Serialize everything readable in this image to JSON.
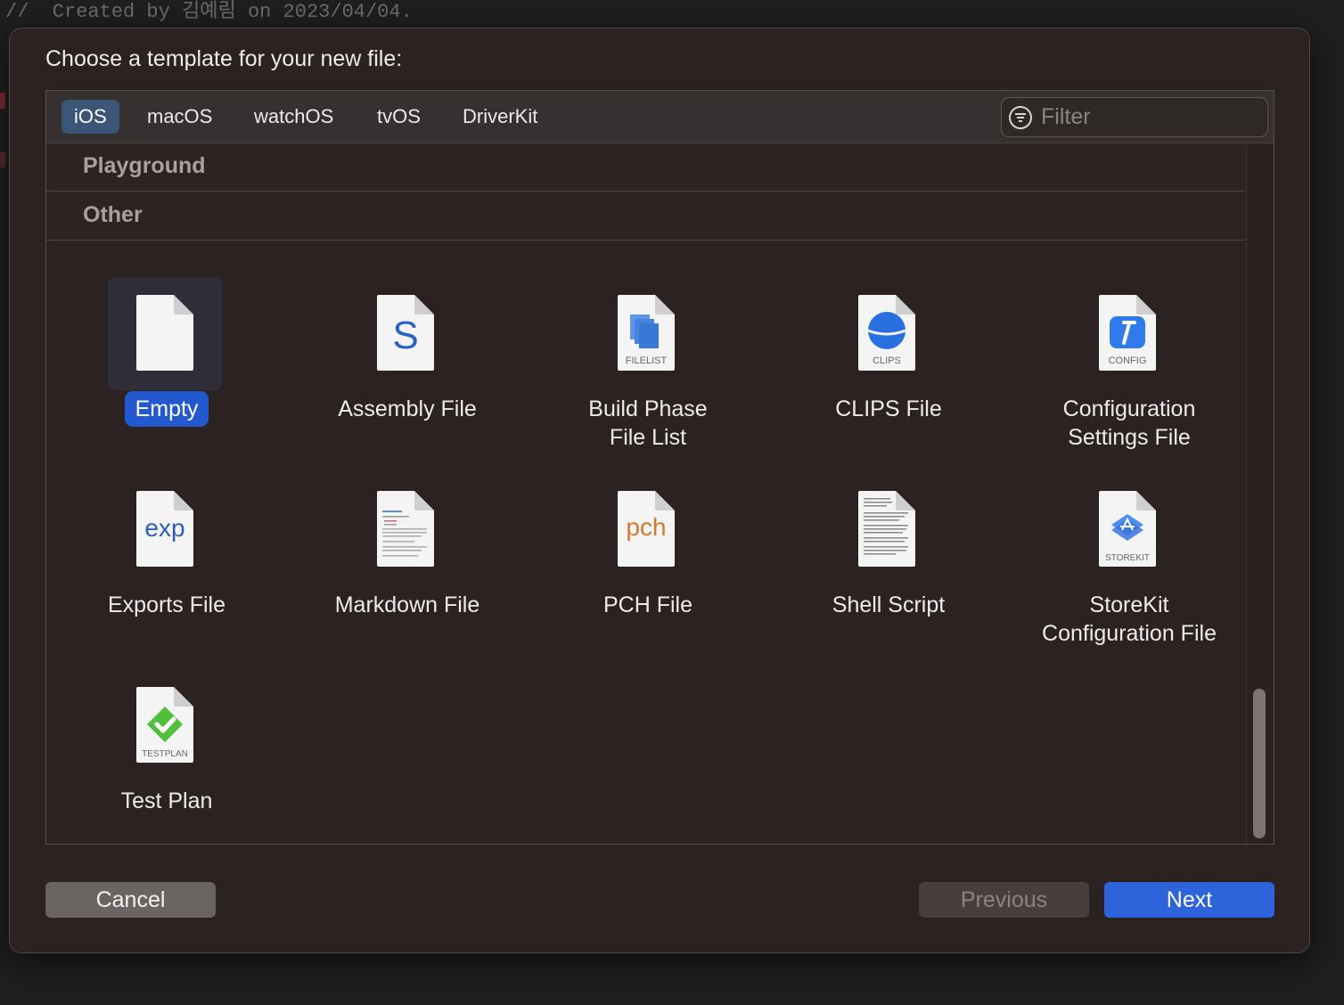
{
  "editor": {
    "comment_line": "//  Created by 김예림 on 2023/04/04."
  },
  "sheet": {
    "title": "Choose a template for your new file:"
  },
  "platform_tabs": [
    {
      "label": "iOS",
      "selected": true
    },
    {
      "label": "macOS",
      "selected": false
    },
    {
      "label": "watchOS",
      "selected": false
    },
    {
      "label": "tvOS",
      "selected": false
    },
    {
      "label": "DriverKit",
      "selected": false
    }
  ],
  "filter": {
    "placeholder": "Filter",
    "value": ""
  },
  "sections": {
    "playground": "Playground",
    "other": "Other"
  },
  "templates": [
    {
      "label": "Empty",
      "icon": "empty-document-icon",
      "badge": "",
      "selected": true
    },
    {
      "label": "Assembly File",
      "icon": "assembly-s-icon",
      "badge": "S",
      "selected": false
    },
    {
      "label": "Build Phase\nFile List",
      "icon": "filelist-icon",
      "badge": "FILELIST",
      "selected": false
    },
    {
      "label": "CLIPS File",
      "icon": "clips-globe-icon",
      "badge": "CLIPS",
      "selected": false
    },
    {
      "label": "Configuration\nSettings File",
      "icon": "config-hammer-icon",
      "badge": "CONFIG",
      "selected": false
    },
    {
      "label": "Exports File",
      "icon": "exp-icon",
      "badge": "exp",
      "selected": false
    },
    {
      "label": "Markdown File",
      "icon": "markdown-document-icon",
      "badge": "",
      "selected": false
    },
    {
      "label": "PCH File",
      "icon": "pch-icon",
      "badge": "pch",
      "selected": false
    },
    {
      "label": "Shell Script",
      "icon": "shell-script-document-icon",
      "badge": "",
      "selected": false
    },
    {
      "label": "StoreKit\nConfiguration File",
      "icon": "storekit-icon",
      "badge": "STOREKIT",
      "selected": false
    },
    {
      "label": "Test Plan",
      "icon": "testplan-checkmark-icon",
      "badge": "TESTPLAN",
      "selected": false
    }
  ],
  "buttons": {
    "cancel": "Cancel",
    "previous": "Previous",
    "next": "Next"
  },
  "colors": {
    "accent_blue": "#2d64db",
    "selected_tab": "#3b5676",
    "sheet_background": "#2b2221"
  }
}
